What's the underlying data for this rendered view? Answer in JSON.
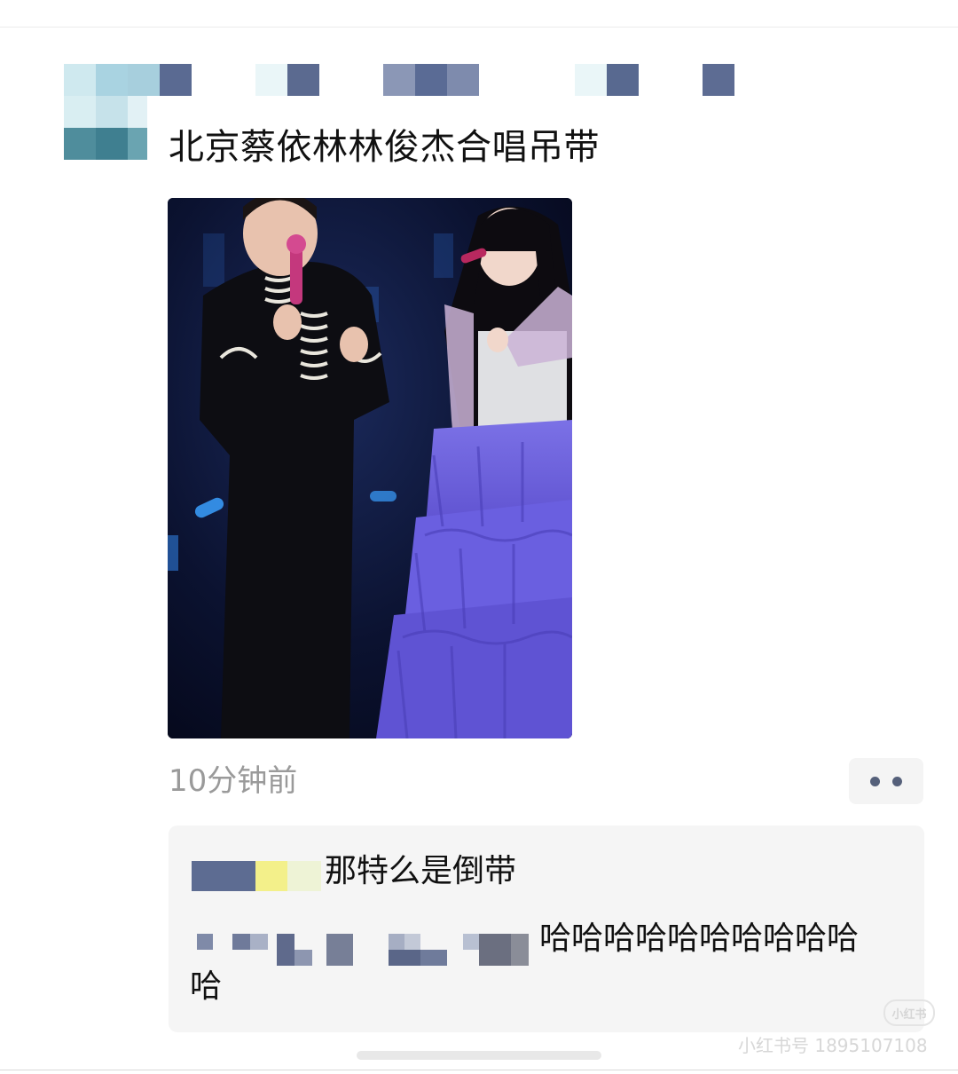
{
  "post": {
    "title": "北京蔡依林林俊杰合唱吊带",
    "timestamp": "10分钟前",
    "image_alt": "concert photo: male singer in black military jacket and female singer in purple tiered gown holding microphones"
  },
  "comments": [
    {
      "text": "那特么是倒带"
    },
    {
      "text": "哈哈哈哈哈哈哈哈哈哈",
      "text_wrap": "哈"
    }
  ],
  "watermark": {
    "logo": "小红书",
    "text": "小红书号 1895107108"
  },
  "icons": {
    "more": "more-dots-icon"
  },
  "colors": {
    "title": "#111111",
    "timestamp": "#9a9a9a",
    "comment_bg": "#f5f5f5",
    "gown": "#6f63d9"
  }
}
